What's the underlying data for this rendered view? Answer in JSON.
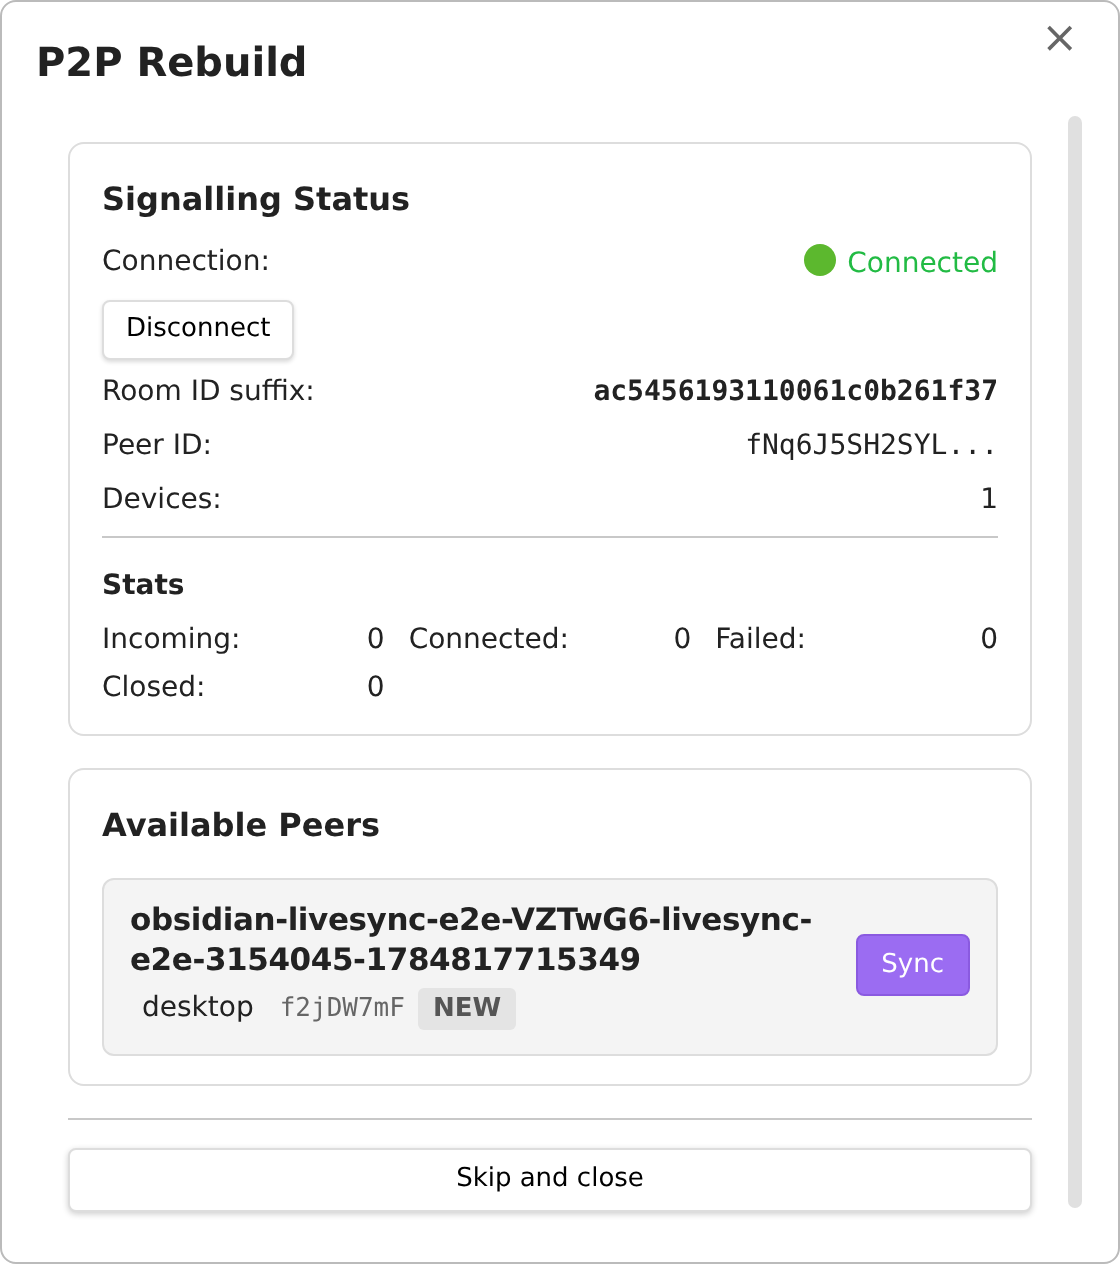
{
  "dialog": {
    "title": "P2P Rebuild",
    "close": "×"
  },
  "signalling": {
    "title": "Signalling Status",
    "connection": {
      "label": "Connection:",
      "value": "Connected",
      "connected": true
    },
    "disconnect_button": "Disconnect",
    "fields": [
      {
        "label": "Room ID suffix:",
        "value": "ac5456193110061c0b261f37",
        "kind": "bold-mono"
      },
      {
        "label": "Peer ID:",
        "value": "fNq6J5SH2SYL...",
        "kind": "mono"
      },
      {
        "label": "Devices:",
        "value": "1",
        "kind": "plain"
      }
    ],
    "stats_title": "Stats",
    "stats": [
      {
        "label": "Incoming:",
        "value": "0"
      },
      {
        "label": "Connected:",
        "value": "0"
      },
      {
        "label": "Failed:",
        "value": "0"
      },
      {
        "label": "Closed:",
        "value": "0"
      }
    ]
  },
  "peers": {
    "title": "Available Peers",
    "items": [
      {
        "name": "obsidian-livesync-e2e-VZTwG6-livesync-e2e-3154045-1784817715349",
        "platform": "desktop",
        "id": "f2jDW7mF",
        "badge": "NEW",
        "button": "Sync"
      }
    ]
  },
  "footer_button": "Skip and close"
}
